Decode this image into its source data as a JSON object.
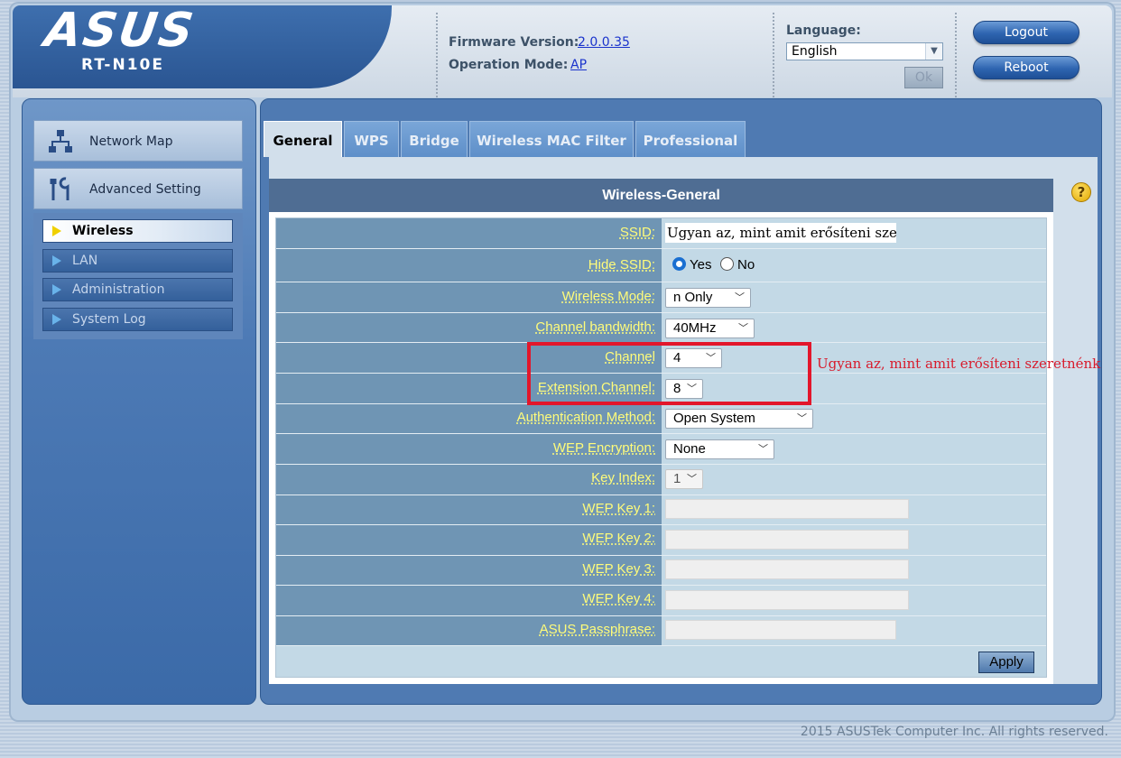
{
  "header": {
    "logo": "ASUS",
    "model": "RT-N10E",
    "firmware_label": "Firmware Version:",
    "firmware_value": "2.0.0.35",
    "mode_label": "Operation Mode:",
    "mode_value": "AP",
    "language_label": "Language:",
    "language_selected": "English",
    "ok_label": "Ok",
    "logout_label": "Logout",
    "reboot_label": "Reboot"
  },
  "nav": {
    "network_map": "Network Map",
    "advanced_setting": "Advanced Setting",
    "sub_items": [
      "Wireless",
      "LAN",
      "Administration",
      "System Log"
    ]
  },
  "tabs": [
    "General",
    "WPS",
    "Bridge",
    "Wireless MAC Filter",
    "Professional"
  ],
  "section_title": "Wireless-General",
  "form": {
    "ssid_label": "SSID:",
    "ssid_value": "Ugyan az, mint amit erősíteni szeretnénk",
    "hide_ssid_label": "Hide SSID:",
    "hide_ssid_yes": "Yes",
    "hide_ssid_no": "No",
    "wireless_mode_label": "Wireless Mode:",
    "wireless_mode_value": "n Only",
    "channel_bw_label": "Channel bandwidth:",
    "channel_bw_value": "40MHz",
    "channel_label": "Channel",
    "channel_value": "4",
    "ext_channel_label": "Extension Channel:",
    "ext_channel_value": "8",
    "auth_label": "Authentication Method:",
    "auth_value": "Open System",
    "wep_enc_label": "WEP Encryption:",
    "wep_enc_value": "None",
    "key_index_label": "Key Index:",
    "key_index_value": "1",
    "wep_key1_label": "WEP Key 1:",
    "wep_key2_label": "WEP Key 2:",
    "wep_key3_label": "WEP Key 3:",
    "wep_key4_label": "WEP Key 4:",
    "passphrase_label": "ASUS Passphrase:",
    "apply_label": "Apply"
  },
  "annotation": "Ugyan az, mint amit erősíteni szeretnénk",
  "footer": "2015 ASUSTek Computer Inc. All rights reserved.",
  "colors": {
    "accent_red": "#e3162b",
    "label_yellow": "#fffc7a",
    "nav_blue": "#4f7ab2"
  }
}
